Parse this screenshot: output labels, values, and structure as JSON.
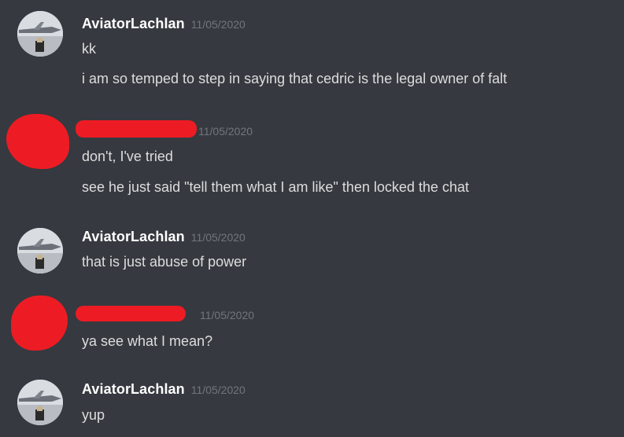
{
  "messages": [
    {
      "username": "AviatorLachlan",
      "timestamp": "11/05/2020",
      "lines": [
        "kk",
        "i am so temped to step in saying that cedric is the legal owner of falt"
      ]
    },
    {
      "username": "",
      "timestamp": "11/05/2020",
      "lines": [
        "don't, I've tried",
        "see he just said \"tell them what I am like\" then locked the chat"
      ]
    },
    {
      "username": "AviatorLachlan",
      "timestamp": "11/05/2020",
      "lines": [
        "that is just abuse of power"
      ]
    },
    {
      "username": "",
      "timestamp": "11/05/2020",
      "lines": [
        "ya see what I mean?"
      ]
    },
    {
      "username": "AviatorLachlan",
      "timestamp": "11/05/2020",
      "lines": [
        "yup"
      ]
    }
  ],
  "colors": {
    "background": "#36393f",
    "username": "#ffffff",
    "timestamp": "#72767d",
    "message_text": "#dcddde",
    "redaction": "#ed1c24"
  },
  "icons": {
    "aviator_avatar": "airplane-avatar-icon"
  }
}
